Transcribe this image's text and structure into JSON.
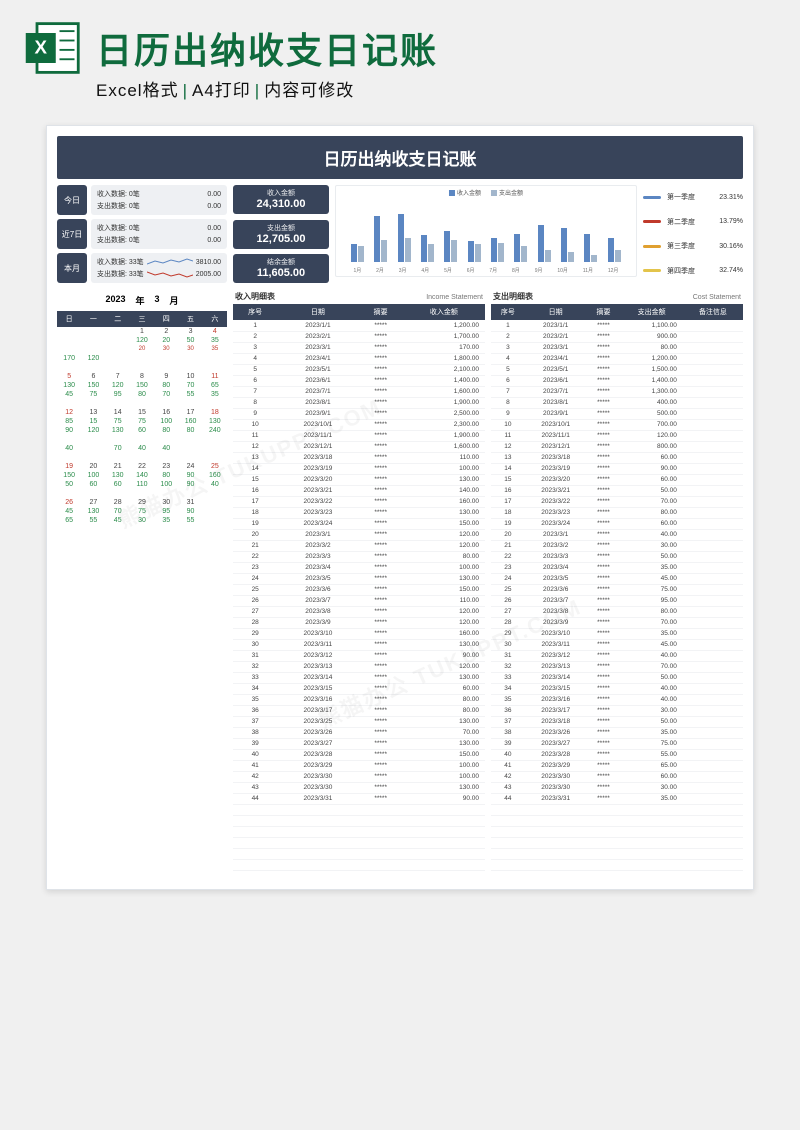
{
  "banner": {
    "title": "日历出纳收支日记账",
    "sub1": "Excel格式",
    "sub2": "A4打印",
    "sub3": "内容可修改"
  },
  "sheet_title": "日历出纳收支日记账",
  "summary": {
    "today": {
      "label": "今日",
      "l1": "收入数据:",
      "l1c": "0笔",
      "l1v": "0.00",
      "l2": "支出数据:",
      "l2c": "0笔",
      "l2v": "0.00"
    },
    "week": {
      "label": "近7日",
      "l1": "收入数据:",
      "l1c": "0笔",
      "l1v": "0.00",
      "l2": "支出数据:",
      "l2c": "0笔",
      "l2v": "0.00"
    },
    "month": {
      "label": "本月",
      "l1": "收入数据:",
      "l1c": "33笔",
      "l1v": "3810.00",
      "l2": "支出数据:",
      "l2c": "33笔",
      "l2v": "2005.00"
    }
  },
  "metrics": {
    "income": {
      "lbl": "收入金额",
      "val": "24,310.00"
    },
    "expense": {
      "lbl": "支出金额",
      "val": "12,705.00"
    },
    "balance": {
      "lbl": "结余金额",
      "val": "11,605.00"
    }
  },
  "chart_legend": {
    "in": "收入金额",
    "out": "支出金额"
  },
  "chart_data": {
    "type": "bar",
    "categories": [
      "1月",
      "2月",
      "3月",
      "4月",
      "5月",
      "6月",
      "7月",
      "8月",
      "9月",
      "10月",
      "11月",
      "12月"
    ],
    "series": [
      {
        "name": "收入金额",
        "values": [
          1200,
          3100,
          3200,
          1800,
          2100,
          1400,
          1600,
          1900,
          2500,
          2300,
          1900,
          1600
        ]
      },
      {
        "name": "支出金额",
        "values": [
          1100,
          1500,
          1600,
          1200,
          1500,
          1200,
          1300,
          1100,
          800,
          700,
          500,
          800
        ]
      }
    ],
    "ylim": [
      0,
      4000
    ]
  },
  "quarters": [
    {
      "name": "第一季度",
      "pct": "23.31%",
      "color": "#5b86c2"
    },
    {
      "name": "第二季度",
      "pct": "13.79%",
      "color": "#c0392b"
    },
    {
      "name": "第三季度",
      "pct": "30.16%",
      "color": "#e0a030"
    },
    {
      "name": "第四季度",
      "pct": "32.74%",
      "color": "#e3c44b"
    }
  ],
  "calendar": {
    "year": "2023",
    "year_suf": "年",
    "month": "3",
    "month_suf": "月",
    "dow": [
      "日",
      "一",
      "二",
      "三",
      "四",
      "五",
      "六"
    ],
    "rows": [
      [
        {
          "d": "",
          "s": ""
        },
        {
          "d": "",
          "s": ""
        },
        {
          "d": "",
          "s": ""
        },
        {
          "d": "1",
          "s": "120",
          "s2": "20"
        },
        {
          "d": "2",
          "s": "20",
          "s2": "30"
        },
        {
          "d": "3",
          "s": "50",
          "s2": "30"
        },
        {
          "d": "4",
          "s": "35",
          "s2": "35"
        }
      ],
      [
        {
          "d": "",
          "s": "170"
        },
        {
          "d": "",
          "s": "120"
        },
        {
          "d": "",
          "s": ""
        },
        {
          "d": "",
          "s": ""
        },
        {
          "d": "",
          "s": ""
        },
        {
          "d": "",
          "s": ""
        },
        {
          "d": "",
          "s": ""
        }
      ],
      [
        {
          "d": "5",
          "s": "130"
        },
        {
          "d": "6",
          "s": "150"
        },
        {
          "d": "7",
          "s": "120"
        },
        {
          "d": "8",
          "s": "150"
        },
        {
          "d": "9",
          "s": "80"
        },
        {
          "d": "10",
          "s": "70"
        },
        {
          "d": "11",
          "s": "65"
        }
      ],
      [
        {
          "d": "",
          "s": "45"
        },
        {
          "d": "",
          "s": "75"
        },
        {
          "d": "",
          "s": "95"
        },
        {
          "d": "",
          "s": "80"
        },
        {
          "d": "",
          "s": "70"
        },
        {
          "d": "",
          "s": "55"
        },
        {
          "d": "",
          "s": "35"
        }
      ],
      [
        {
          "d": "12",
          "s": "85"
        },
        {
          "d": "13",
          "s": "15"
        },
        {
          "d": "14",
          "s": "75"
        },
        {
          "d": "15",
          "s": "75"
        },
        {
          "d": "16",
          "s": "100"
        },
        {
          "d": "17",
          "s": "160"
        },
        {
          "d": "18",
          "s": "130"
        }
      ],
      [
        {
          "d": "",
          "s": "90"
        },
        {
          "d": "",
          "s": "120"
        },
        {
          "d": "",
          "s": "130"
        },
        {
          "d": "",
          "s": "60"
        },
        {
          "d": "",
          "s": "80"
        },
        {
          "d": "",
          "s": "80"
        },
        {
          "d": "",
          "s": "240"
        }
      ],
      [
        {
          "d": "",
          "s": "40"
        },
        {
          "d": "",
          "s": ""
        },
        {
          "d": "",
          "s": "70"
        },
        {
          "d": "",
          "s": "40"
        },
        {
          "d": "",
          "s": "40"
        },
        {
          "d": "",
          "s": ""
        },
        {
          "d": "",
          "s": ""
        }
      ],
      [
        {
          "d": "19",
          "s": "150"
        },
        {
          "d": "20",
          "s": "100"
        },
        {
          "d": "21",
          "s": "130"
        },
        {
          "d": "22",
          "s": "140"
        },
        {
          "d": "23",
          "s": "80"
        },
        {
          "d": "24",
          "s": "90"
        },
        {
          "d": "25",
          "s": "160"
        }
      ],
      [
        {
          "d": "",
          "s": "50"
        },
        {
          "d": "",
          "s": "60"
        },
        {
          "d": "",
          "s": "60"
        },
        {
          "d": "",
          "s": "110"
        },
        {
          "d": "",
          "s": "100"
        },
        {
          "d": "",
          "s": "90"
        },
        {
          "d": "",
          "s": "40"
        }
      ],
      [
        {
          "d": "26",
          "s": "45"
        },
        {
          "d": "27",
          "s": "130"
        },
        {
          "d": "28",
          "s": "70"
        },
        {
          "d": "29",
          "s": "75"
        },
        {
          "d": "30",
          "s": "95"
        },
        {
          "d": "31",
          "s": "90"
        },
        {
          "d": "",
          "s": ""
        }
      ],
      [
        {
          "d": "",
          "s": "65"
        },
        {
          "d": "",
          "s": "55"
        },
        {
          "d": "",
          "s": "45"
        },
        {
          "d": "",
          "s": "30"
        },
        {
          "d": "",
          "s": "35"
        },
        {
          "d": "",
          "s": "55"
        },
        {
          "d": "",
          "s": ""
        }
      ]
    ]
  },
  "income_table": {
    "title": "收入明细表",
    "subtitle": "Income Statement",
    "headers": [
      "序号",
      "日期",
      "摘要",
      "收入金额"
    ],
    "rows": [
      [
        "1",
        "2023/1/1",
        "*****",
        "1,200.00"
      ],
      [
        "2",
        "2023/2/1",
        "*****",
        "1,700.00"
      ],
      [
        "3",
        "2023/3/1",
        "*****",
        "170.00"
      ],
      [
        "4",
        "2023/4/1",
        "*****",
        "1,800.00"
      ],
      [
        "5",
        "2023/5/1",
        "*****",
        "2,100.00"
      ],
      [
        "6",
        "2023/6/1",
        "*****",
        "1,400.00"
      ],
      [
        "7",
        "2023/7/1",
        "*****",
        "1,600.00"
      ],
      [
        "8",
        "2023/8/1",
        "*****",
        "1,900.00"
      ],
      [
        "9",
        "2023/9/1",
        "*****",
        "2,500.00"
      ],
      [
        "10",
        "2023/10/1",
        "*****",
        "2,300.00"
      ],
      [
        "11",
        "2023/11/1",
        "*****",
        "1,900.00"
      ],
      [
        "12",
        "2023/12/1",
        "*****",
        "1,600.00"
      ],
      [
        "13",
        "2023/3/18",
        "*****",
        "110.00"
      ],
      [
        "14",
        "2023/3/19",
        "*****",
        "100.00"
      ],
      [
        "15",
        "2023/3/20",
        "*****",
        "130.00"
      ],
      [
        "16",
        "2023/3/21",
        "*****",
        "140.00"
      ],
      [
        "17",
        "2023/3/22",
        "*****",
        "160.00"
      ],
      [
        "18",
        "2023/3/23",
        "*****",
        "130.00"
      ],
      [
        "19",
        "2023/3/24",
        "*****",
        "150.00"
      ],
      [
        "20",
        "2023/3/1",
        "*****",
        "120.00"
      ],
      [
        "21",
        "2023/3/2",
        "*****",
        "120.00"
      ],
      [
        "22",
        "2023/3/3",
        "*****",
        "80.00"
      ],
      [
        "23",
        "2023/3/4",
        "*****",
        "100.00"
      ],
      [
        "24",
        "2023/3/5",
        "*****",
        "130.00"
      ],
      [
        "25",
        "2023/3/6",
        "*****",
        "150.00"
      ],
      [
        "26",
        "2023/3/7",
        "*****",
        "110.00"
      ],
      [
        "27",
        "2023/3/8",
        "*****",
        "120.00"
      ],
      [
        "28",
        "2023/3/9",
        "*****",
        "120.00"
      ],
      [
        "29",
        "2023/3/10",
        "*****",
        "160.00"
      ],
      [
        "30",
        "2023/3/11",
        "*****",
        "130.00"
      ],
      [
        "31",
        "2023/3/12",
        "*****",
        "90.00"
      ],
      [
        "32",
        "2023/3/13",
        "*****",
        "120.00"
      ],
      [
        "33",
        "2023/3/14",
        "*****",
        "130.00"
      ],
      [
        "34",
        "2023/3/15",
        "*****",
        "60.00"
      ],
      [
        "35",
        "2023/3/16",
        "*****",
        "80.00"
      ],
      [
        "36",
        "2023/3/17",
        "*****",
        "80.00"
      ],
      [
        "37",
        "2023/3/25",
        "*****",
        "130.00"
      ],
      [
        "38",
        "2023/3/26",
        "*****",
        "70.00"
      ],
      [
        "39",
        "2023/3/27",
        "*****",
        "130.00"
      ],
      [
        "40",
        "2023/3/28",
        "*****",
        "150.00"
      ],
      [
        "41",
        "2023/3/29",
        "*****",
        "100.00"
      ],
      [
        "42",
        "2023/3/30",
        "*****",
        "100.00"
      ],
      [
        "43",
        "2023/3/30",
        "*****",
        "130.00"
      ],
      [
        "44",
        "2023/3/31",
        "*****",
        "90.00"
      ]
    ]
  },
  "expense_table": {
    "title": "支出明细表",
    "subtitle": "Cost Statement",
    "headers": [
      "序号",
      "日期",
      "摘要",
      "支出金额",
      "备注信息"
    ],
    "rows": [
      [
        "1",
        "2023/1/1",
        "*****",
        "1,100.00",
        ""
      ],
      [
        "2",
        "2023/2/1",
        "*****",
        "900.00",
        ""
      ],
      [
        "3",
        "2023/3/1",
        "*****",
        "80.00",
        ""
      ],
      [
        "4",
        "2023/4/1",
        "*****",
        "1,200.00",
        ""
      ],
      [
        "5",
        "2023/5/1",
        "*****",
        "1,500.00",
        ""
      ],
      [
        "6",
        "2023/6/1",
        "*****",
        "1,400.00",
        ""
      ],
      [
        "7",
        "2023/7/1",
        "*****",
        "1,300.00",
        ""
      ],
      [
        "8",
        "2023/8/1",
        "*****",
        "400.00",
        ""
      ],
      [
        "9",
        "2023/9/1",
        "*****",
        "500.00",
        ""
      ],
      [
        "10",
        "2023/10/1",
        "*****",
        "700.00",
        ""
      ],
      [
        "11",
        "2023/11/1",
        "*****",
        "120.00",
        ""
      ],
      [
        "12",
        "2023/12/1",
        "*****",
        "800.00",
        ""
      ],
      [
        "13",
        "2023/3/18",
        "*****",
        "60.00",
        ""
      ],
      [
        "14",
        "2023/3/19",
        "*****",
        "90.00",
        ""
      ],
      [
        "15",
        "2023/3/20",
        "*****",
        "60.00",
        ""
      ],
      [
        "16",
        "2023/3/21",
        "*****",
        "50.00",
        ""
      ],
      [
        "17",
        "2023/3/22",
        "*****",
        "70.00",
        ""
      ],
      [
        "18",
        "2023/3/23",
        "*****",
        "80.00",
        ""
      ],
      [
        "19",
        "2023/3/24",
        "*****",
        "60.00",
        ""
      ],
      [
        "20",
        "2023/3/1",
        "*****",
        "40.00",
        ""
      ],
      [
        "21",
        "2023/3/2",
        "*****",
        "30.00",
        ""
      ],
      [
        "22",
        "2023/3/3",
        "*****",
        "50.00",
        ""
      ],
      [
        "23",
        "2023/3/4",
        "*****",
        "35.00",
        ""
      ],
      [
        "24",
        "2023/3/5",
        "*****",
        "45.00",
        ""
      ],
      [
        "25",
        "2023/3/6",
        "*****",
        "75.00",
        ""
      ],
      [
        "26",
        "2023/3/7",
        "*****",
        "95.00",
        ""
      ],
      [
        "27",
        "2023/3/8",
        "*****",
        "80.00",
        ""
      ],
      [
        "28",
        "2023/3/9",
        "*****",
        "70.00",
        ""
      ],
      [
        "29",
        "2023/3/10",
        "*****",
        "35.00",
        ""
      ],
      [
        "30",
        "2023/3/11",
        "*****",
        "45.00",
        ""
      ],
      [
        "31",
        "2023/3/12",
        "*****",
        "40.00",
        ""
      ],
      [
        "32",
        "2023/3/13",
        "*****",
        "70.00",
        ""
      ],
      [
        "33",
        "2023/3/14",
        "*****",
        "50.00",
        ""
      ],
      [
        "34",
        "2023/3/15",
        "*****",
        "40.00",
        ""
      ],
      [
        "35",
        "2023/3/16",
        "*****",
        "40.00",
        ""
      ],
      [
        "36",
        "2023/3/17",
        "*****",
        "30.00",
        ""
      ],
      [
        "37",
        "2023/3/18",
        "*****",
        "50.00",
        ""
      ],
      [
        "38",
        "2023/3/26",
        "*****",
        "35.00",
        ""
      ],
      [
        "39",
        "2023/3/27",
        "*****",
        "75.00",
        ""
      ],
      [
        "40",
        "2023/3/28",
        "*****",
        "55.00",
        ""
      ],
      [
        "41",
        "2023/3/29",
        "*****",
        "65.00",
        ""
      ],
      [
        "42",
        "2023/3/30",
        "*****",
        "60.00",
        ""
      ],
      [
        "43",
        "2023/3/30",
        "*****",
        "30.00",
        ""
      ],
      [
        "44",
        "2023/3/31",
        "*****",
        "35.00",
        ""
      ]
    ]
  }
}
